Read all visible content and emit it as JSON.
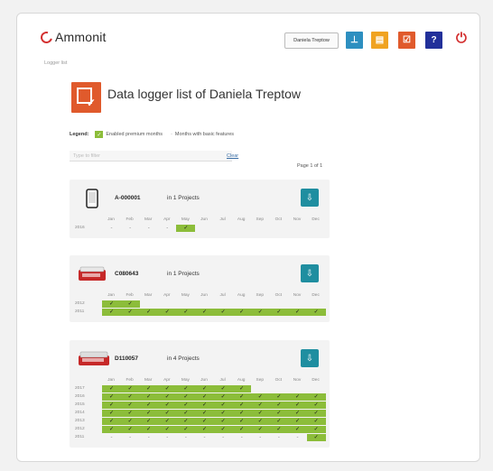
{
  "header": {
    "logo_text": "Ammonit",
    "user_button": "Daniela Treptow",
    "icons": [
      {
        "name": "station-icon",
        "color": "#2d8fc0",
        "glyph": "⊥"
      },
      {
        "name": "folder-icon",
        "color": "#f0a321",
        "glyph": "▤"
      },
      {
        "name": "logger-list-icon",
        "color": "#e05a2c",
        "glyph": "☑"
      },
      {
        "name": "help-icon",
        "color": "#22309a",
        "glyph": "?"
      }
    ],
    "logout_glyph": "⏻"
  },
  "breadcrumb": "Logger list",
  "page_title": "Data logger list of Daniela Treptow",
  "legend": {
    "label": "Legend:",
    "premium_check": "✓",
    "premium": "Enabled premium months",
    "basic_dash": "-",
    "basic": "Months with basic features"
  },
  "filter": {
    "placeholder": "Type to filter",
    "clear": "Clear"
  },
  "page_info": "Page 1 of 1",
  "months": [
    "Jan",
    "Feb",
    "Mar",
    "Apr",
    "May",
    "Jun",
    "Jul",
    "Aug",
    "Sep",
    "Oct",
    "Nov",
    "Dec"
  ],
  "loggers": [
    {
      "name": "A-000001",
      "projects": "in 1 Projects",
      "rows": [
        {
          "year": "2016",
          "cells": [
            "-",
            "-",
            "-",
            "-",
            "✓",
            "",
            "",
            "",
            "",
            "",
            "",
            ""
          ]
        }
      ]
    },
    {
      "name": "C080643",
      "projects": "in 1 Projects",
      "rows": [
        {
          "year": "2012",
          "cells": [
            "✓",
            "✓",
            "",
            "",
            "",
            "",
            "",
            "",
            "",
            "",
            "",
            ""
          ]
        },
        {
          "year": "2011",
          "cells": [
            "✓",
            "✓",
            "✓",
            "✓",
            "✓",
            "✓",
            "✓",
            "✓",
            "✓",
            "✓",
            "✓",
            "✓"
          ]
        }
      ]
    },
    {
      "name": "D110057",
      "projects": "in 4 Projects",
      "rows": [
        {
          "year": "2017",
          "cells": [
            "✓",
            "✓",
            "✓",
            "✓",
            "✓",
            "✓",
            "✓",
            "✓",
            "",
            "",
            "",
            ""
          ]
        },
        {
          "year": "2016",
          "cells": [
            "✓",
            "✓",
            "✓",
            "✓",
            "✓",
            "✓",
            "✓",
            "✓",
            "✓",
            "✓",
            "✓",
            "✓"
          ]
        },
        {
          "year": "2015",
          "cells": [
            "✓",
            "✓",
            "✓",
            "✓",
            "✓",
            "✓",
            "✓",
            "✓",
            "✓",
            "✓",
            "✓",
            "✓"
          ]
        },
        {
          "year": "2014",
          "cells": [
            "✓",
            "✓",
            "✓",
            "✓",
            "✓",
            "✓",
            "✓",
            "✓",
            "✓",
            "✓",
            "✓",
            "✓"
          ]
        },
        {
          "year": "2013",
          "cells": [
            "✓",
            "✓",
            "✓",
            "✓",
            "✓",
            "✓",
            "✓",
            "✓",
            "✓",
            "✓",
            "✓",
            "✓"
          ]
        },
        {
          "year": "2012",
          "cells": [
            "✓",
            "✓",
            "✓",
            "✓",
            "✓",
            "✓",
            "✓",
            "✓",
            "✓",
            "✓",
            "✓",
            "✓"
          ]
        },
        {
          "year": "2011",
          "cells": [
            "-",
            "-",
            "-",
            "-",
            "-",
            "-",
            "-",
            "-",
            "-",
            "-",
            "-",
            "✓"
          ]
        }
      ]
    }
  ],
  "download_glyph": "⇩"
}
